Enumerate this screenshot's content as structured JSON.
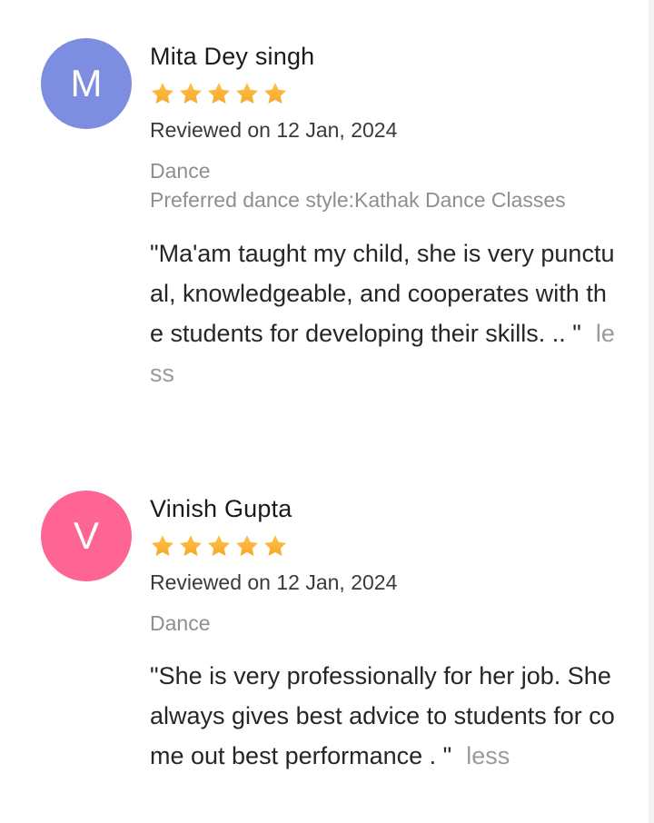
{
  "reviews": [
    {
      "initial": "M",
      "avatar_color": "#7d8ee0",
      "name": "Mita Dey singh",
      "rating": 5,
      "reviewed": "Reviewed on 12 Jan, 2024",
      "category": "Dance",
      "preference": "Preferred dance style:Kathak Dance Classes",
      "text": "\"Ma'am taught my child, she is very punctual, knowledgeable, and cooperates with the students for developing their skills. .. \"",
      "less_label": "less"
    },
    {
      "initial": "V",
      "avatar_color": "#ff6594",
      "name": "Vinish Gupta",
      "rating": 5,
      "reviewed": "Reviewed on 12 Jan, 2024",
      "category": "Dance",
      "text": "\"She is very professionally for her job. She always gives best advice to students for come out best performance . \"",
      "less_label": "less"
    }
  ],
  "colors": {
    "star": "#f7a82a",
    "star_light": "#ffc24a"
  },
  "icons": {
    "star": "star-icon"
  }
}
